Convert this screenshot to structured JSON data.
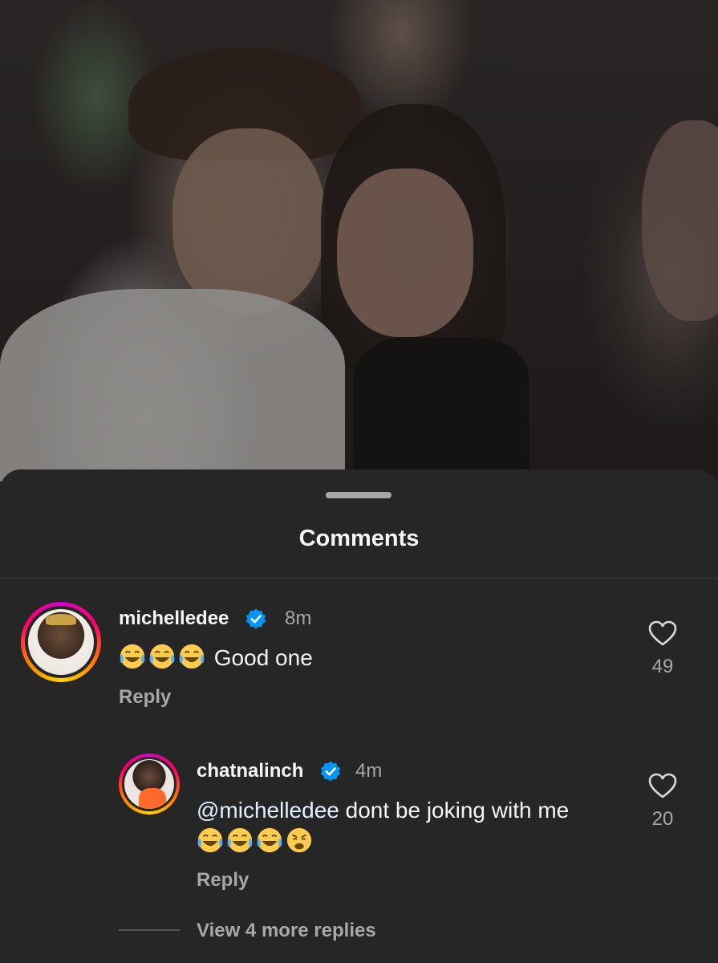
{
  "background": {
    "description_icon": "photo-post"
  },
  "sheet": {
    "title": "Comments"
  },
  "comments": [
    {
      "username": "michelledee",
      "verified": true,
      "time": "8m",
      "text": "Good one",
      "emojis": [
        "face-with-tears-of-joy",
        "face-with-tears-of-joy",
        "face-with-tears-of-joy"
      ],
      "reply_label": "Reply",
      "likes": "49"
    },
    {
      "username": "chatnalinch",
      "verified": true,
      "time": "4m",
      "mention": "@michelledee",
      "text": "dont be joking with me",
      "emojis": [
        "face-with-tears-of-joy",
        "face-with-tears-of-joy",
        "face-with-tears-of-joy",
        "weary-face"
      ],
      "reply_label": "Reply",
      "likes": "20"
    }
  ],
  "view_more_replies": "View 4 more replies",
  "colors": {
    "sheet_bg": "#262626",
    "verified_blue": "#0095f6",
    "secondary_text": "#a8a8a8"
  }
}
